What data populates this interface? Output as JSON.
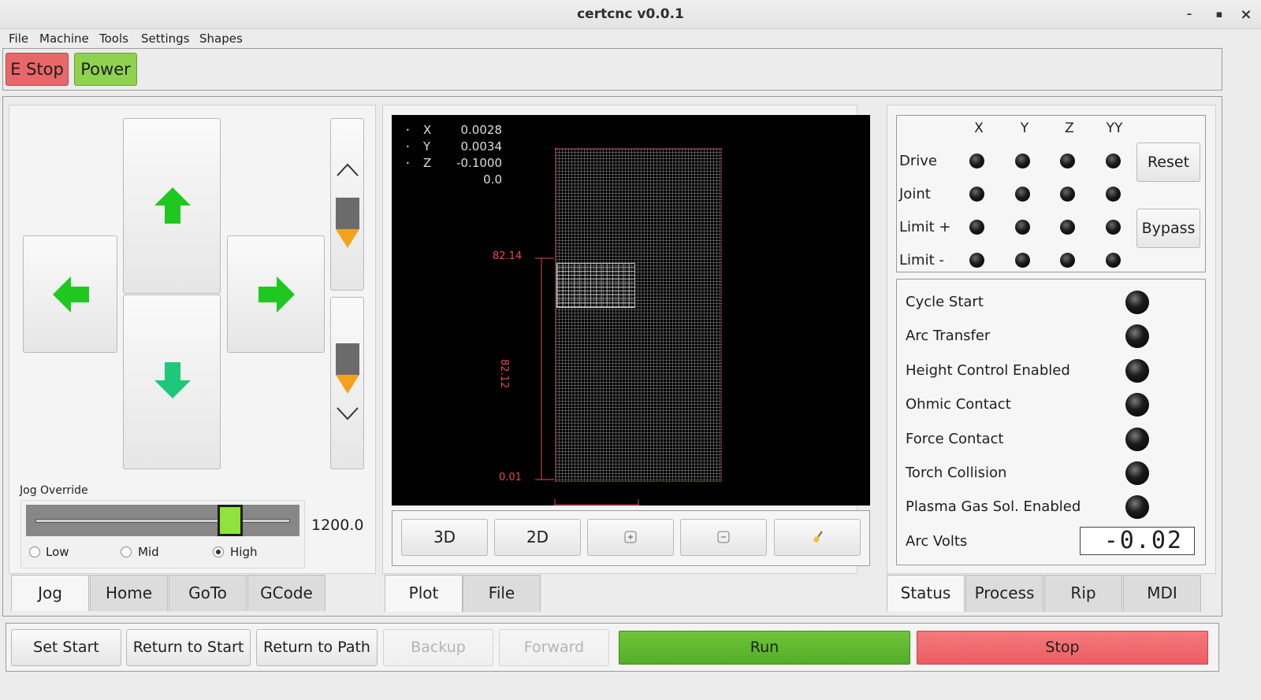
{
  "window": {
    "title": "certcnc v0.0.1",
    "minimize": "–",
    "maximize": "▪",
    "close": "×"
  },
  "menu": [
    "File",
    "Machine",
    "Tools",
    "Settings",
    "Shapes"
  ],
  "toolbar": {
    "estop": "E Stop",
    "power": "Power"
  },
  "jog": {
    "override_label": "Jog Override",
    "override_value": "1200.0",
    "override_fraction": 0.77,
    "speed_options": [
      "Low",
      "Mid",
      "High"
    ],
    "speed_selected": "High"
  },
  "left_tabs": [
    "Jog",
    "Home",
    "GoTo",
    "GCode"
  ],
  "left_tab_active": "Jog",
  "plot": {
    "coords": [
      {
        "axis": "X",
        "value": "0.0028"
      },
      {
        "axis": "Y",
        "value": "0.0034"
      },
      {
        "axis": "Z",
        "value": "-0.1000"
      },
      {
        "axis": "",
        "value": "0.0"
      }
    ],
    "dim_top": "82.14",
    "dim_mid": "82.12",
    "dim_bottom": "0.01",
    "buttons": {
      "view3d": "3D",
      "view2d": "2D"
    }
  },
  "mid_tabs": [
    "Plot",
    "File"
  ],
  "mid_tab_active": "Plot",
  "axes_table": {
    "columns": [
      "X",
      "Y",
      "Z",
      "YY"
    ],
    "rows": [
      "Drive",
      "Joint",
      "Limit +",
      "Limit -"
    ],
    "reset": "Reset",
    "bypass": "Bypass"
  },
  "status": {
    "items": [
      "Cycle Start",
      "Arc Transfer",
      "Height Control Enabled",
      "Ohmic Contact",
      "Force Contact",
      "Torch Collision",
      "Plasma Gas Sol. Enabled"
    ],
    "arc_volts_label": "Arc Volts",
    "arc_volts_value": "-0.02"
  },
  "right_tabs": [
    "Status",
    "Process",
    "Rip",
    "MDI"
  ],
  "right_tab_active": "Status",
  "bottom": {
    "set_start": "Set Start",
    "return_start": "Return to Start",
    "return_path": "Return to Path",
    "backup": "Backup",
    "forward": "Forward",
    "run": "Run",
    "stop": "Stop"
  },
  "colors": {
    "estop": "#e8686a",
    "power": "#8fd24f",
    "run": "#5cb72f",
    "stop": "#f06a6e",
    "arrow": "#1ec81e",
    "dim": "#e84a4a"
  }
}
